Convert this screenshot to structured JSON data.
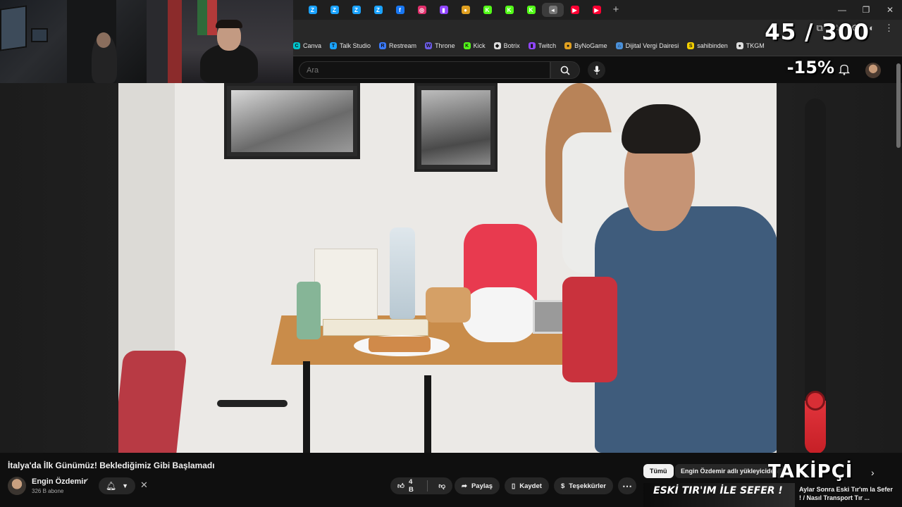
{
  "tabs": [
    {
      "icon": "bolt-tab-icon",
      "color": "#1aa3ff",
      "glyph": "Z"
    },
    {
      "icon": "bolt-tab-icon",
      "color": "#1aa3ff",
      "glyph": "Z"
    },
    {
      "icon": "bolt-tab-icon",
      "color": "#1aa3ff",
      "glyph": "Z"
    },
    {
      "icon": "bolt-tab-icon",
      "color": "#1aa3ff",
      "glyph": "Z"
    },
    {
      "icon": "facebook-tab-icon",
      "color": "#1877f2",
      "glyph": "f"
    },
    {
      "icon": "instagram-tab-icon",
      "color": "#e1306c",
      "glyph": "◎"
    },
    {
      "icon": "twitch-tab-icon",
      "color": "#9146ff",
      "glyph": "▮"
    },
    {
      "icon": "bynogame-tab-icon",
      "color": "#e0a020",
      "glyph": "●"
    },
    {
      "icon": "kick-tab-icon",
      "color": "#53fc18",
      "glyph": "K"
    },
    {
      "icon": "kick-tab-icon",
      "color": "#53fc18",
      "glyph": "K"
    },
    {
      "icon": "kick-tab-icon",
      "color": "#53fc18",
      "glyph": "K"
    },
    {
      "icon": "speaker-tab-icon",
      "color": "#777777",
      "glyph": "◂"
    },
    {
      "icon": "youtube-tab-icon",
      "color": "#ff0033",
      "glyph": "▶"
    },
    {
      "icon": "youtube-tab-icon",
      "color": "#ff0033",
      "glyph": "▶"
    }
  ],
  "bookmarks": [
    {
      "label": "Canva",
      "color": "#00c4cc",
      "glyph": "C"
    },
    {
      "label": "Talk Studio",
      "color": "#1aa3ff",
      "glyph": "T"
    },
    {
      "label": "Restream",
      "color": "#3a7bff",
      "glyph": "R"
    },
    {
      "label": "Throne",
      "color": "#6c5ce7",
      "glyph": "W"
    },
    {
      "label": "Kick",
      "color": "#53fc18",
      "glyph": "K"
    },
    {
      "label": "Botrix",
      "color": "#dddddd",
      "glyph": "◆"
    },
    {
      "label": "Twitch",
      "color": "#9146ff",
      "glyph": "▮"
    },
    {
      "label": "ByNoGame",
      "color": "#e0a020",
      "glyph": "●"
    },
    {
      "label": "Dijital Vergi Dairesi",
      "color": "#4a90d9",
      "glyph": "⌂"
    },
    {
      "label": "sahibinden",
      "color": "#f5d000",
      "glyph": "S"
    },
    {
      "label": "TKGM",
      "color": "#dddddd",
      "glyph": "●"
    }
  ],
  "search": {
    "placeholder": "Ara"
  },
  "overlay": {
    "counter": "45 / 300",
    "percent": "-15%",
    "meter_level": 0.15,
    "followers_label": "TAKİPÇİ"
  },
  "video": {
    "title": "İtalya'da İlk Günümüz! Beklediğimiz Gibi Başlamadı",
    "channel": "Engin Özdemir",
    "subscribers": "326 B abone",
    "likes": "4 B",
    "share": "Paylaş",
    "save": "Kaydet",
    "thanks": "Teşekkürler"
  },
  "chips": {
    "all": "Tümü",
    "uploads": "Engin Özdemir adlı yükleyiciden"
  },
  "recommendation": {
    "thumb_text": "ESKİ TIR'IM İLE SEFER !",
    "title": "Aylar Sonra Eski Tır'ım la Sefer ! / Nasıl Transport Tır ..."
  }
}
